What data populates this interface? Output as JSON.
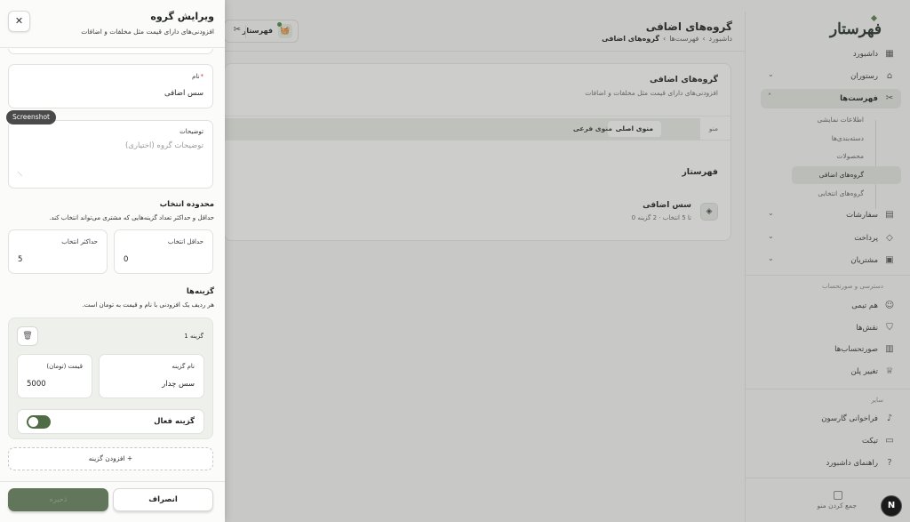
{
  "topbar": {
    "title": "گروه‌های اضافی",
    "breadcrumb": [
      "داشبورد",
      "فهرست‌ها",
      "گروه‌های اضافی"
    ],
    "store_name": "فهرستار"
  },
  "main": {
    "card_title": "گروه‌های اضافی",
    "card_subtitle": "افزودنی‌های دارای قیمت مثل مخلفات و اضافات",
    "menu_label": "منو",
    "menu_tabs": [
      "منوی اصلی",
      "منوی فرعی"
    ],
    "group_heading": "فهرستار",
    "group_item": {
      "name": "سس اضافی",
      "meta": "0 تا 5 انتخاب · 2 گزینه"
    }
  },
  "sidebar": {
    "logo": "فهرستار",
    "items": [
      {
        "label": "داشبورد",
        "icon": "dashboard-icon"
      },
      {
        "label": "رستوران",
        "icon": "store-icon"
      },
      {
        "label": "فهرست‌ها",
        "icon": "utensils-icon",
        "active": true
      },
      {
        "label": "سفارشات",
        "icon": "orders-icon"
      },
      {
        "label": "پرداخت",
        "icon": "tag-icon"
      },
      {
        "label": "مشتریان",
        "icon": "customers-icon"
      }
    ],
    "submenu": [
      "اطلاعات نمایشی",
      "دسته‌بندی‌ها",
      "محصولات",
      "گروه‌های اضافی",
      "گروه‌های انتخابی"
    ],
    "access_section": "دسترسی و صورتحساب",
    "access_items": [
      "هم تیمی",
      "نقش‌ها",
      "صورتحساب‌ها",
      "تغییر پلن"
    ],
    "other_section": "سایر",
    "other_items": [
      "فراخوانی گارسون",
      "تیکت",
      "راهنمای داشبورد"
    ],
    "collapse_label": "جمع کردن منو"
  },
  "drawer": {
    "title": "ویرایش گروه",
    "subtitle": "افزودنی‌های دارای قیمت مثل مخلفات و اضافات",
    "name_label": "نام",
    "name_required": "*",
    "name_value": "سس اضافی",
    "desc_label": "توضیحات",
    "desc_placeholder": "توضیحات گروه (اختیاری)",
    "range_title": "محدوده انتخاب",
    "range_desc": "حداقل و حداکثر تعداد گزینه‌هایی که مشتری می‌تواند انتخاب کند.",
    "min_label": "حداقل انتخاب",
    "min_value": "0",
    "max_label": "حداکثر انتخاب",
    "max_value": "5",
    "options_title": "گزینه‌ها",
    "options_desc": "هر ردیف یک افزودنی با نام و قیمت به تومان است.",
    "option": {
      "header": "گزینه 1",
      "name_label": "نام گزینه",
      "name_value": "سس چدار",
      "price_label": "قیمت (تومان)",
      "price_value": "5000",
      "active_label": "گزینه فعال",
      "active": true
    },
    "add_option_label": "افزودن گزینه",
    "cancel_label": "انصراف",
    "save_label": "ذخیره"
  },
  "overlay_pill": "Screenshot",
  "colors": {
    "accent": "#566b4f",
    "toggle": "#4f6c46"
  }
}
